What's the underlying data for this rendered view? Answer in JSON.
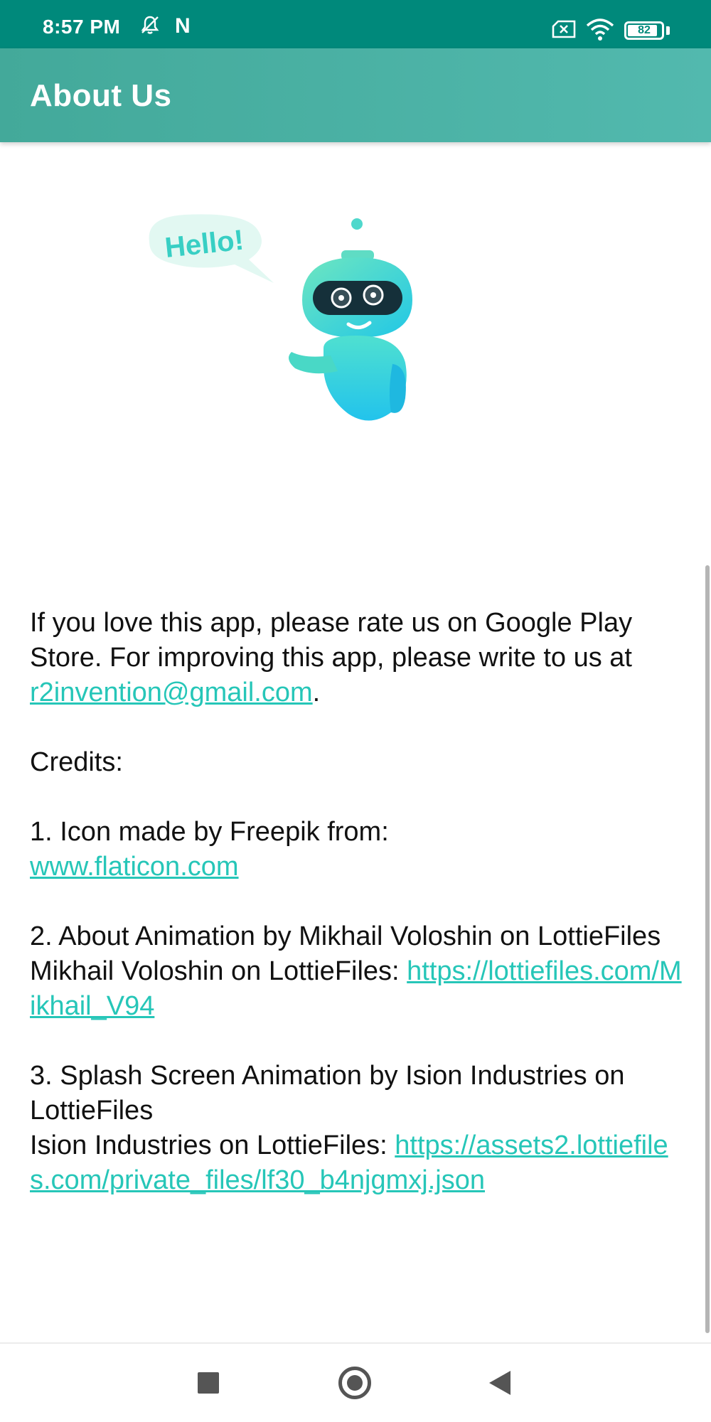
{
  "status_bar": {
    "time": "8:57 PM",
    "notification_app": "N",
    "battery_level": "82",
    "icons": [
      "bell-muted-icon",
      "netflix-icon",
      "sim-off-icon",
      "wifi-icon",
      "battery-icon"
    ]
  },
  "app_bar": {
    "title": "About Us",
    "background_color": "#4db6ac"
  },
  "illustration": {
    "icon": "robot-hello-illustration",
    "speech_bubble_text": "Hello!"
  },
  "content": {
    "intro_text": "If you love this app, please rate us on Google Play Store. For improving this app, please write to us at ",
    "email_link": "r2invention@gmail.com",
    "intro_end": ".",
    "credits_heading": "Credits:",
    "credit1_text": "1. Icon made by Freepik from:",
    "credit1_link": "www.flaticon.com",
    "credit2_line1": "2. About Animation by Mikhail Voloshin on LottieFiles",
    "credit2_prefix": "Mikhail Voloshin on LottieFiles: ",
    "credit2_link": "https://lottiefiles.com/Mikhail_V94",
    "credit3_line1": "3. Splash Screen Animation by Ision Industries on LottieFiles",
    "credit3_prefix": "Ision Industries on LottieFiles: ",
    "credit3_link": "https://assets2.lottiefiles.com/private_files/lf30_b4njgmxj.json",
    "link_color": "#26c6b8"
  },
  "nav_bar": {
    "icons": [
      "recents-square-icon",
      "home-circle-icon",
      "back-triangle-icon"
    ]
  }
}
